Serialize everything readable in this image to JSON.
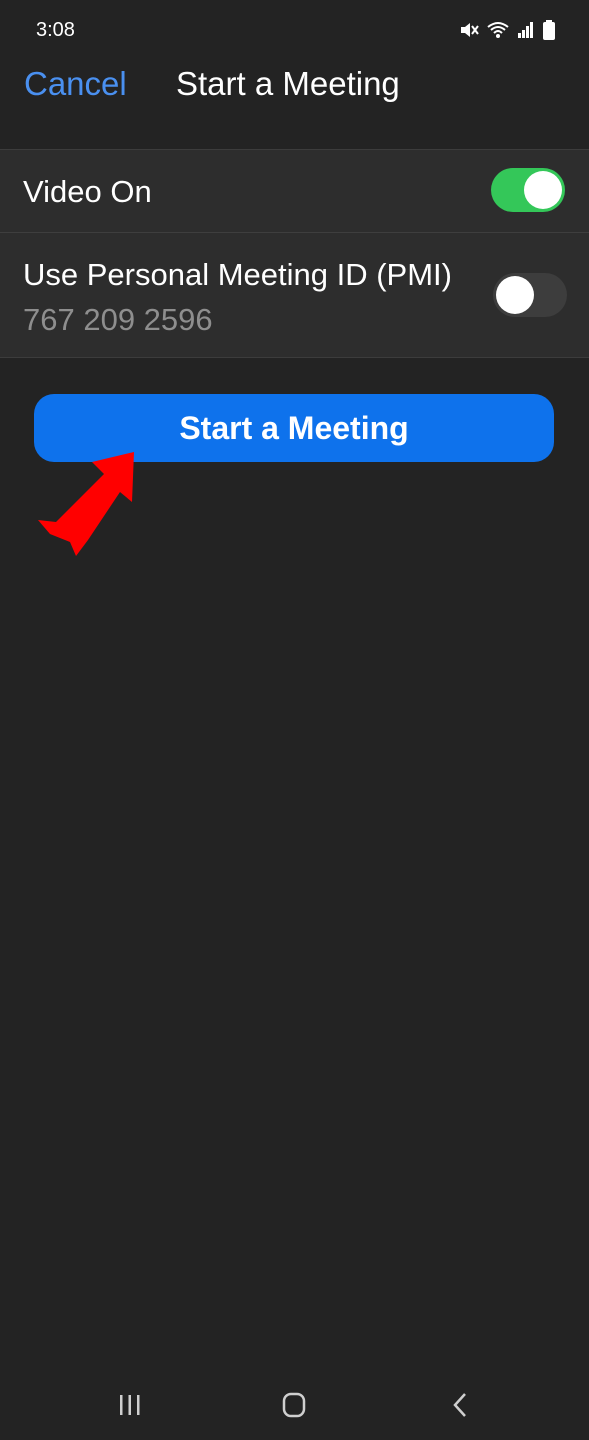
{
  "status_bar": {
    "time": "3:08",
    "icons": [
      "mute-icon",
      "wifi-icon",
      "signal-icon",
      "battery-icon"
    ]
  },
  "header": {
    "cancel_label": "Cancel",
    "title": "Start a Meeting"
  },
  "settings": {
    "video_on": {
      "label": "Video On",
      "enabled": true
    },
    "pmi": {
      "label": "Use Personal Meeting ID (PMI)",
      "meeting_id": "767 209 2596",
      "enabled": false
    }
  },
  "start_button": {
    "label": "Start a Meeting"
  },
  "annotation": {
    "icon": "red-arrow-icon"
  },
  "nav_bar": {
    "items": [
      "recent-apps-icon",
      "home-icon",
      "back-icon"
    ]
  },
  "colors": {
    "background": "#232323",
    "accent_blue": "#0e72ec",
    "link_blue": "#4a90f0",
    "toggle_green": "#34c759",
    "arrow_red": "#ff0000"
  }
}
